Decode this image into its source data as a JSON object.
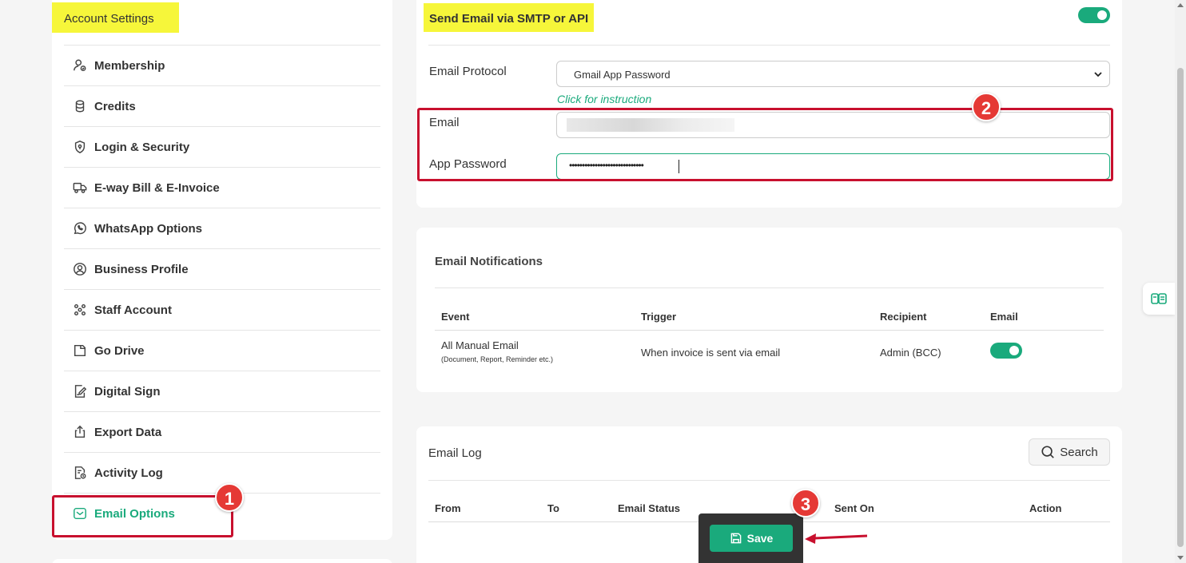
{
  "sidebar": {
    "title": "Account Settings",
    "items": [
      {
        "label": "Membership",
        "icon": "user-badge-icon"
      },
      {
        "label": "Credits",
        "icon": "coins-icon"
      },
      {
        "label": "Login & Security",
        "icon": "shield-icon"
      },
      {
        "label": "E-way Bill & E-Invoice",
        "icon": "truck-icon"
      },
      {
        "label": "WhatsApp Options",
        "icon": "whatsapp-icon"
      },
      {
        "label": "Business Profile",
        "icon": "user-circle-icon"
      },
      {
        "label": "Staff Account",
        "icon": "team-icon"
      },
      {
        "label": "Go Drive",
        "icon": "drive-icon"
      },
      {
        "label": "Digital Sign",
        "icon": "sign-icon"
      },
      {
        "label": "Export Data",
        "icon": "upload-icon"
      },
      {
        "label": "Activity Log",
        "icon": "log-icon"
      },
      {
        "label": "Email Options",
        "icon": "mail-icon",
        "active": true
      }
    ]
  },
  "smtp": {
    "title": "Send Email via SMTP or API",
    "enabled": true,
    "protocol_label": "Email Protocol",
    "protocol_value": "Gmail App Password",
    "instruction_link": "Click for instruction",
    "email_label": "Email",
    "password_label": "App Password",
    "password_value": "•••••••••••••••••••••••••••••"
  },
  "notifications": {
    "title": "Email Notifications",
    "headers": [
      "Event",
      "Trigger",
      "Recipient",
      "Email"
    ],
    "row": {
      "event": "All Manual Email",
      "event_sub": "(Document, Report, Reminder etc.)",
      "trigger": "When invoice is sent via email",
      "recipient": "Admin (BCC)",
      "email_enabled": true
    }
  },
  "email_log": {
    "title": "Email Log",
    "search_label": "Search",
    "headers": [
      "From",
      "To",
      "Email Status",
      "Sent On",
      "Action"
    ]
  },
  "save_label": "Save",
  "markers": [
    "1",
    "2",
    "3"
  ],
  "colors": {
    "accent": "#1aaa7c",
    "highlight": "#f6f63a",
    "annotation": "#c8102e"
  }
}
